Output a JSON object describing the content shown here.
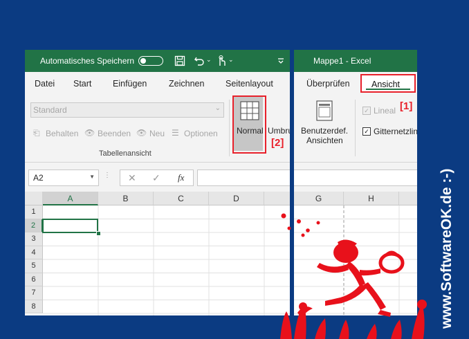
{
  "titlebar": {
    "autosave_label": "Automatisches Speichern",
    "workbook_title": "Mappe1  -  Excel"
  },
  "tabs": [
    "Datei",
    "Start",
    "Einfügen",
    "Zeichnen",
    "Seitenlayout",
    "Überprüfen",
    "Ansicht"
  ],
  "ribbon": {
    "view_dropdown_value": "Standard",
    "sheetview_buttons": [
      "Behalten",
      "Beenden",
      "Neu",
      "Optionen"
    ],
    "group_label": "Tabellenansicht",
    "normal_label": "Normal",
    "umbruch_label": "Umbruch",
    "custom_view_line1": "Benutzerdef.",
    "custom_view_line2": "Ansichten",
    "lineal_label": "Lineal",
    "gitternetz_label": "Gitternetzlin"
  },
  "formula_bar": {
    "name_box": "A2",
    "cancel_glyph": "✕",
    "enter_glyph": "✓",
    "fx_glyph": "fx"
  },
  "columns": [
    "A",
    "B",
    "C",
    "D",
    "G",
    "H"
  ],
  "rows": [
    "1",
    "2",
    "3",
    "4",
    "5",
    "6",
    "7",
    "8"
  ],
  "annotations": {
    "label1": "[1]",
    "label2": "[2]"
  },
  "watermark": "www.SoftwareOK.de :-)",
  "colors": {
    "excel_green": "#217346",
    "frame_blue": "#0b3b82",
    "highlight_red": "#e8202a"
  }
}
